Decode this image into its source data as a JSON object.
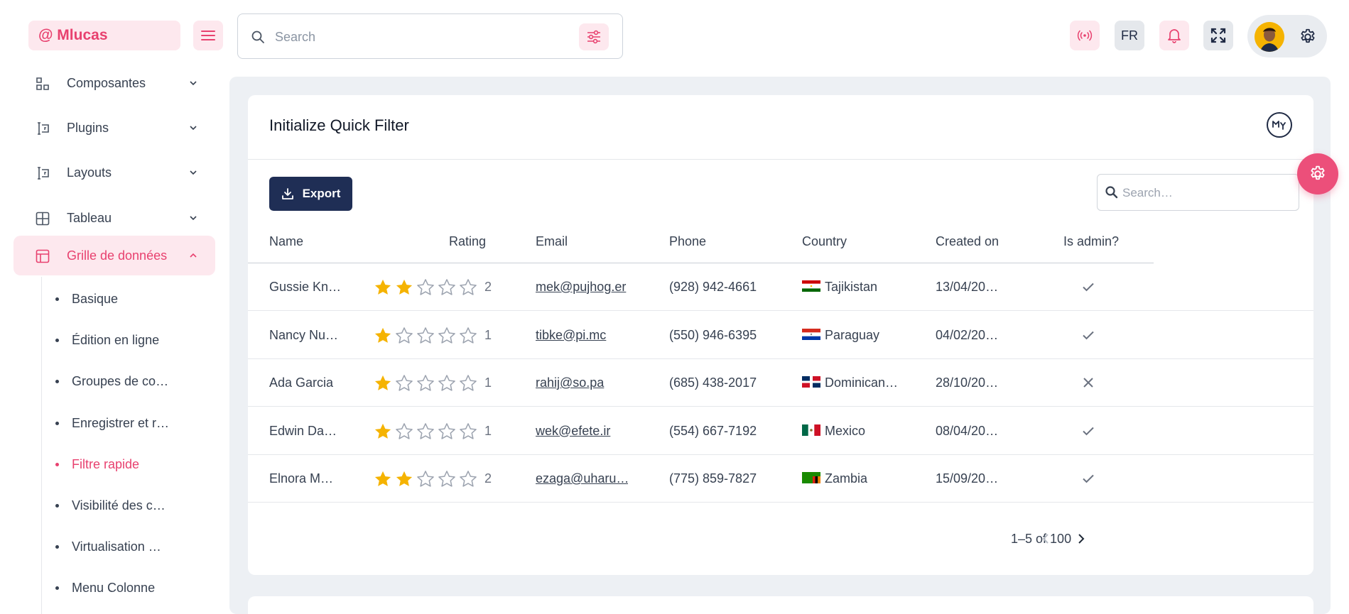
{
  "header": {
    "logo": "@ Mlucas",
    "search_placeholder": "Search",
    "language": "FR"
  },
  "sidebar": {
    "items": [
      {
        "label": "Composantes",
        "icon": "components-icon"
      },
      {
        "label": "Plugins",
        "icon": "plugin-icon"
      },
      {
        "label": "Layouts",
        "icon": "layout-icon"
      },
      {
        "label": "Tableau",
        "icon": "table-icon"
      },
      {
        "label": "Grille de données",
        "icon": "grid-icon",
        "active": true
      }
    ],
    "subitems": [
      {
        "label": "Basique"
      },
      {
        "label": "Édition en ligne"
      },
      {
        "label": "Groupes de co…"
      },
      {
        "label": "Enregistrer et r…"
      },
      {
        "label": "Filtre rapide",
        "active": true
      },
      {
        "label": "Visibilité des c…"
      },
      {
        "label": "Virtualisation …"
      },
      {
        "label": "Menu Colonne"
      }
    ]
  },
  "card": {
    "title": "Initialize Quick Filter",
    "export_label": "Export",
    "quick_search_placeholder": "Search…"
  },
  "grid": {
    "columns": [
      "Name",
      "Rating",
      "Email",
      "Phone",
      "Country",
      "Created on",
      "Is admin?"
    ],
    "rows": [
      {
        "name": "Gussie Kn…",
        "rating": 2,
        "rating_label": "2",
        "email": "mek@pujhog.er",
        "phone": "(928) 942-4661",
        "country": "Tajikistan",
        "flag": "tj",
        "created": "13/04/20…",
        "admin": true
      },
      {
        "name": "Nancy Nu…",
        "rating": 1,
        "rating_label": "1",
        "email": "tibke@pi.mc",
        "phone": "(550) 946-6395",
        "country": "Paraguay",
        "flag": "py",
        "created": "04/02/20…",
        "admin": true
      },
      {
        "name": "Ada Garcia",
        "rating": 1,
        "rating_label": "1",
        "email": "rahij@so.pa",
        "phone": "(685) 438-2017",
        "country": "Dominican…",
        "flag": "do",
        "created": "28/10/20…",
        "admin": false
      },
      {
        "name": "Edwin Da…",
        "rating": 1,
        "rating_label": "1",
        "email": "wek@efete.ir",
        "phone": "(554) 667-7192",
        "country": "Mexico",
        "flag": "mx",
        "created": "08/04/20…",
        "admin": true
      },
      {
        "name": "Elnora M…",
        "rating": 2,
        "rating_label": "2",
        "email": "ezaga@uharu…",
        "phone": "(775) 859-7827",
        "country": "Zambia",
        "flag": "zm",
        "created": "15/09/20…",
        "admin": true
      }
    ],
    "pagination": "1–5 of 100"
  },
  "colors": {
    "accent_pink": "#e8416f",
    "navy": "#1f2e55",
    "star": "#f5b301"
  }
}
